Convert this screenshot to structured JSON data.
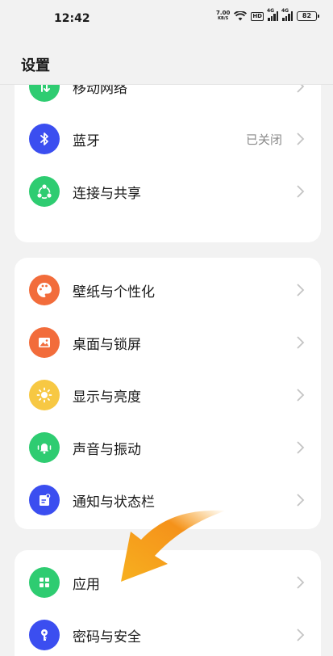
{
  "status": {
    "time": "12:42",
    "speed_value": "7.00",
    "speed_unit": "KB/S",
    "hd": "HD",
    "net1": "4G",
    "net2": "4G",
    "battery": "82"
  },
  "header": {
    "title": "设置"
  },
  "colors": {
    "green": "#2ecc71",
    "blue": "#3b4ef0",
    "orange": "#f26c3b",
    "yellow": "#f7c843",
    "arrow": "#f7a21b",
    "chevron": "#c4c4c4"
  },
  "groups": [
    {
      "items": [
        {
          "id": "mobile-network",
          "label": "移动网络",
          "icon": "mobile-data-icon",
          "color": "#2ecc71"
        },
        {
          "id": "bluetooth",
          "label": "蓝牙",
          "value": "已关闭",
          "icon": "bluetooth-icon",
          "color": "#3b4ef0"
        },
        {
          "id": "connect-share",
          "label": "连接与共享",
          "icon": "share-icon",
          "color": "#2ecc71"
        }
      ]
    },
    {
      "items": [
        {
          "id": "wallpaper",
          "label": "壁纸与个性化",
          "icon": "palette-icon",
          "color": "#f26c3b"
        },
        {
          "id": "desktop-lock",
          "label": "桌面与锁屏",
          "icon": "image-icon",
          "color": "#f26c3b"
        },
        {
          "id": "display",
          "label": "显示与亮度",
          "icon": "sun-icon",
          "color": "#f7c843"
        },
        {
          "id": "sound",
          "label": "声音与振动",
          "icon": "bell-icon",
          "color": "#2ecc71"
        },
        {
          "id": "notification",
          "label": "通知与状态栏",
          "icon": "notification-icon",
          "color": "#3b4ef0"
        }
      ]
    },
    {
      "items": [
        {
          "id": "apps",
          "label": "应用",
          "icon": "apps-grid-icon",
          "color": "#2ecc71"
        },
        {
          "id": "password",
          "label": "密码与安全",
          "icon": "key-icon",
          "color": "#3b4ef0"
        }
      ]
    }
  ]
}
